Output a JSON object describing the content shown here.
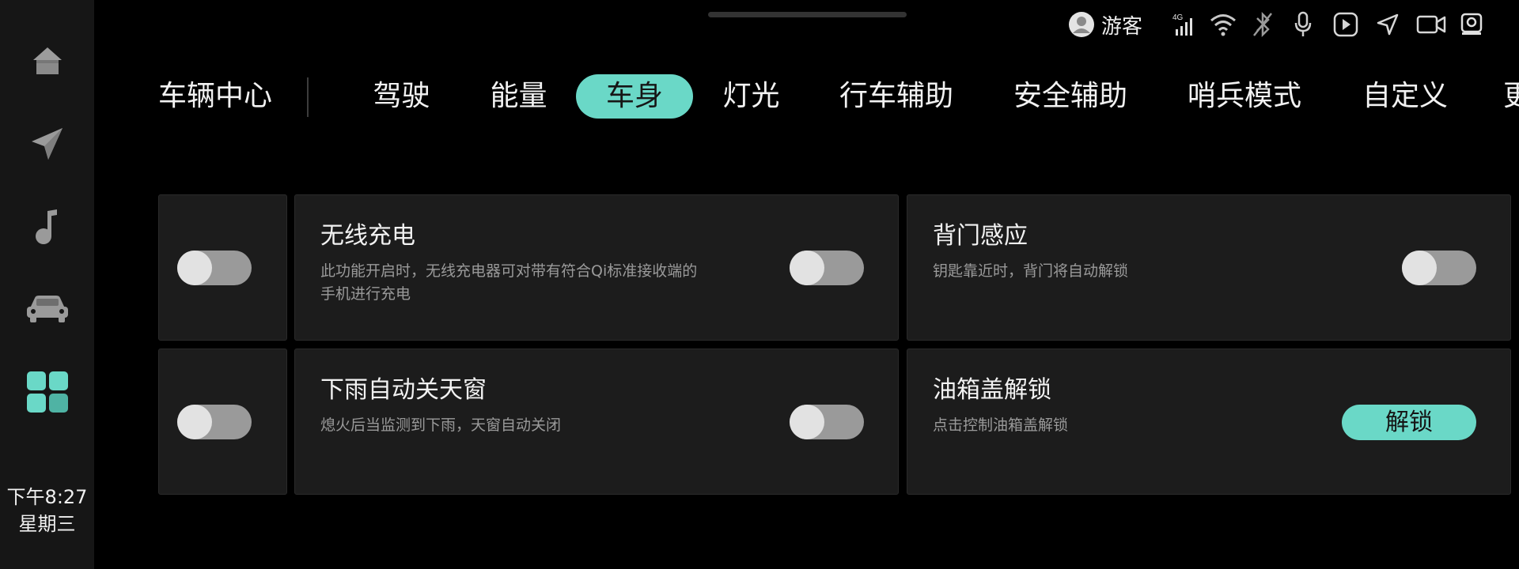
{
  "dock": {
    "items": [
      {
        "name": "home-icon"
      },
      {
        "name": "navigation-icon"
      },
      {
        "name": "music-icon"
      },
      {
        "name": "car-icon"
      },
      {
        "name": "apps-icon"
      }
    ],
    "time": "下午8:27",
    "weekday": "星期三"
  },
  "status": {
    "user": "游客",
    "network": "4G",
    "icons": [
      "avatar-icon",
      "signal-4g-icon",
      "wifi-icon",
      "bluetooth-off-icon",
      "microphone-icon",
      "play-icon",
      "location-arrow-icon",
      "camera-icon",
      "dashcam-icon"
    ]
  },
  "header": {
    "title": "车辆中心",
    "tabs": [
      {
        "label": "驾驶"
      },
      {
        "label": "能量"
      },
      {
        "label": "车身"
      },
      {
        "label": "灯光"
      },
      {
        "label": "行车辅助"
      },
      {
        "label": "安全辅助"
      },
      {
        "label": "哨兵模式"
      },
      {
        "label": "自定义"
      },
      {
        "label": "更"
      }
    ],
    "active_tab": "车身"
  },
  "cards": {
    "wireless_charging": {
      "title": "无线充电",
      "desc_line1": "此功能开启时，无线充电器可对带有符合Qi标准接收端的",
      "desc_line2": "手机进行充电",
      "enabled": false
    },
    "tailgate_sensing": {
      "title": "背门感应",
      "desc": "钥匙靠近时，背门将自动解锁",
      "enabled": false
    },
    "rain_close_sunroof": {
      "title": "下雨自动关天窗",
      "desc": "熄火后当监测到下雨，天窗自动关闭",
      "enabled": false
    },
    "fuel_cap_unlock": {
      "title": "油箱盖解锁",
      "desc": "点击控制油箱盖解锁",
      "button": "解锁"
    },
    "left_partial_top": {
      "enabled": false
    },
    "left_partial_bottom": {
      "enabled": false
    }
  },
  "colors": {
    "accent": "#6AD8C7",
    "background": "#000000",
    "dock": "#161616",
    "card": "#1C1C1C",
    "toggle_track_off": "#9A9A9A",
    "muted_text": "#9A9A9A"
  }
}
